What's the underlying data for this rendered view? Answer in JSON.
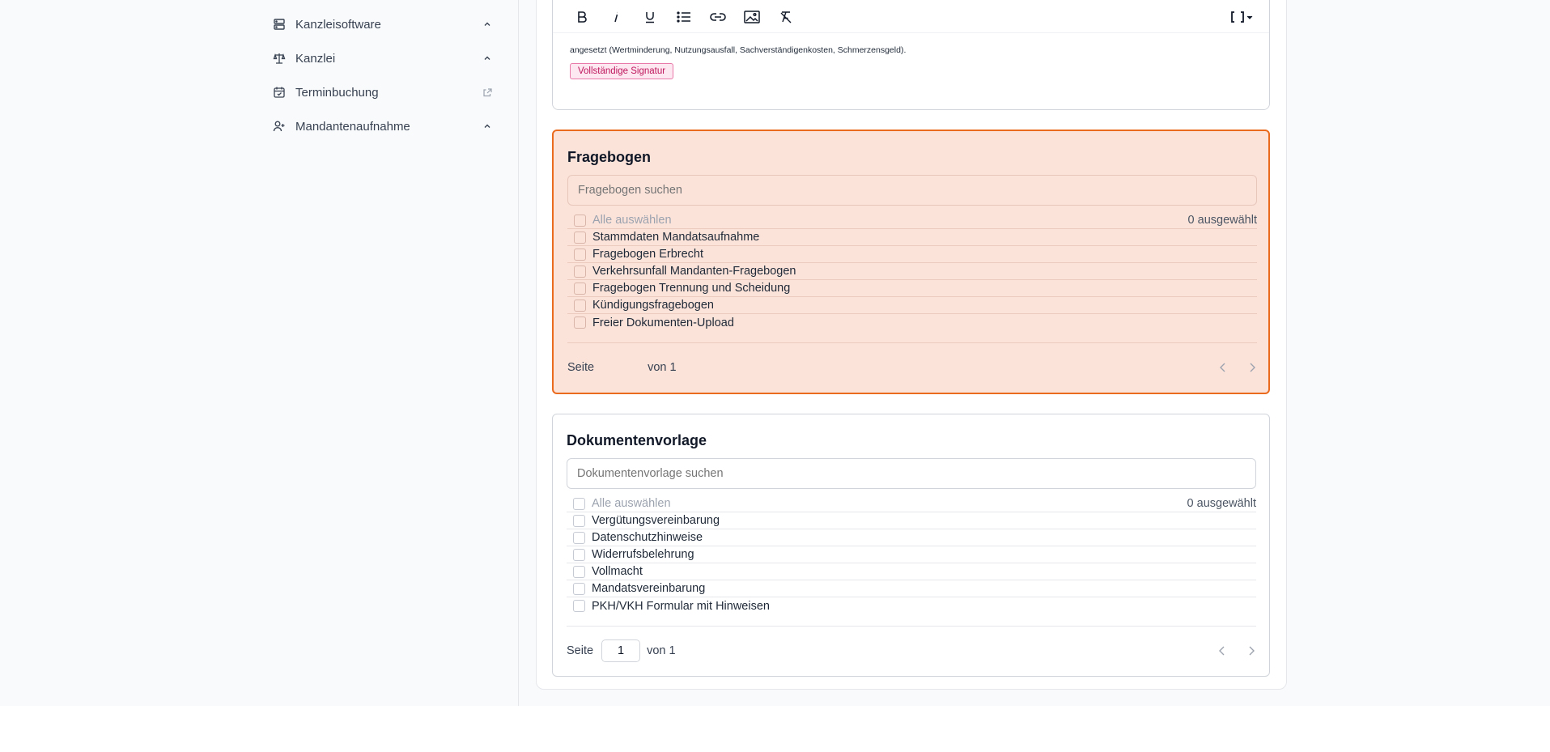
{
  "sidebar": {
    "items": [
      {
        "label": "Kanzleisoftware",
        "icon": "server-icon",
        "trailing": "chevron-up-icon"
      },
      {
        "label": "Kanzlei",
        "icon": "scale-icon",
        "trailing": "chevron-up-icon"
      },
      {
        "label": "Terminbuchung",
        "icon": "calendar-check-icon",
        "trailing": "external-link-icon"
      },
      {
        "label": "Mandantenaufnahme",
        "icon": "user-plus-icon",
        "trailing": "chevron-up-icon"
      }
    ]
  },
  "editor": {
    "toolbar": [
      "bold-icon",
      "italic-icon",
      "underline-icon",
      "list-icon",
      "link-icon",
      "image-icon",
      "clear-format-icon",
      "brackets-icon"
    ],
    "text": "angesetzt (Wertminderung, Nutzungsausfall, Sachverständigenkosten, Schmerzensgeld).",
    "badge": "Vollständige Signatur"
  },
  "fragebogen": {
    "title": "Fragebogen",
    "search_placeholder": "Fragebogen suchen",
    "select_all": "Alle auswählen",
    "selected_count": "0 ausgewählt",
    "items": [
      "Stammdaten Mandatsaufnahme",
      "Fragebogen Erbrecht",
      "Verkehrsunfall Mandanten-Fragebogen",
      "Fragebogen Trennung und Scheidung",
      "Kündigungsfragebogen",
      "Freier Dokumenten-Upload"
    ],
    "page_label": "Seite",
    "page_value": "",
    "page_total": "von 1",
    "highlight_color": "#ea6a1e"
  },
  "dokumentenvorlage": {
    "title": "Dokumentenvorlage",
    "search_placeholder": "Dokumentenvorlage suchen",
    "select_all": "Alle auswählen",
    "selected_count": "0 ausgewählt",
    "items": [
      "Vergütungsvereinbarung",
      "Datenschutzhinweise",
      "Widerrufsbelehrung",
      "Vollmacht",
      "Mandatsvereinbarung",
      "PKH/VKH Formular mit Hinweisen"
    ],
    "page_label": "Seite",
    "page_value": "1",
    "page_total": "von 1"
  }
}
